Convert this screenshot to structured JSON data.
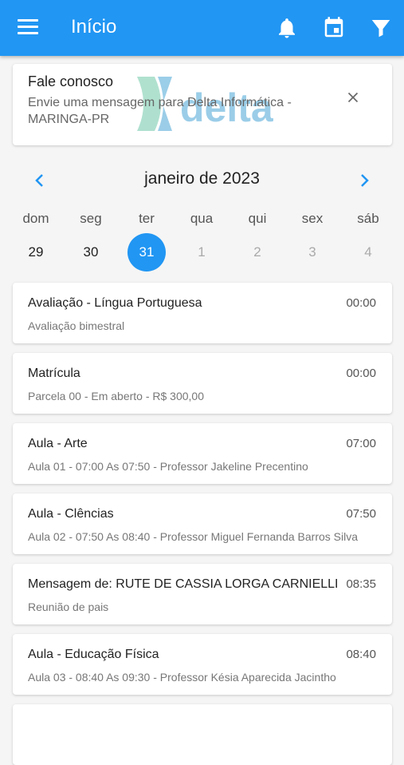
{
  "appbar": {
    "title": "Início",
    "menu_icon": "menu-icon",
    "icons": [
      "bell-icon",
      "calendar-icon",
      "filter-icon"
    ]
  },
  "contact": {
    "title": "Fale conosco",
    "description": "Envie uma mensagem para Delta Informática - MARINGA-PR",
    "logo_text": "delta"
  },
  "calendar": {
    "month_label": "janeiro de 2023",
    "days": [
      {
        "name": "dom",
        "num": "29"
      },
      {
        "name": "seg",
        "num": "30"
      },
      {
        "name": "ter",
        "num": "31"
      },
      {
        "name": "qua",
        "num": "1"
      },
      {
        "name": "qui",
        "num": "2"
      },
      {
        "name": "sex",
        "num": "3"
      },
      {
        "name": "sáb",
        "num": "4"
      }
    ],
    "selected_index": 2
  },
  "events": [
    {
      "title": "Avaliação - Língua Portuguesa",
      "time": "00:00",
      "subtitle": "Avaliação bimestral"
    },
    {
      "title": "Matrícula",
      "time": "00:00",
      "subtitle": "Parcela 00 - Em aberto - R$ 300,00"
    },
    {
      "title": "Aula - Arte",
      "time": "07:00",
      "subtitle": "Aula 01 - 07:00 As 07:50 - Professor Jakeline Precentino"
    },
    {
      "title": "Aula - Clências",
      "time": "07:50",
      "subtitle": "Aula 02 - 07:50 As 08:40 - Professor Miguel Fernanda Barros Silva"
    },
    {
      "title": "Mensagem de: RUTE DE CASSIA LORGA CARNIELLI",
      "time": "08:35",
      "subtitle": "Reunião de pais"
    },
    {
      "title": "Aula - Educação Física",
      "time": "08:40",
      "subtitle": "Aula 03 - 08:40 As 09:30 - Professor Késia Aparecida Jacintho"
    }
  ],
  "colors": {
    "accent": "#2196F3"
  }
}
